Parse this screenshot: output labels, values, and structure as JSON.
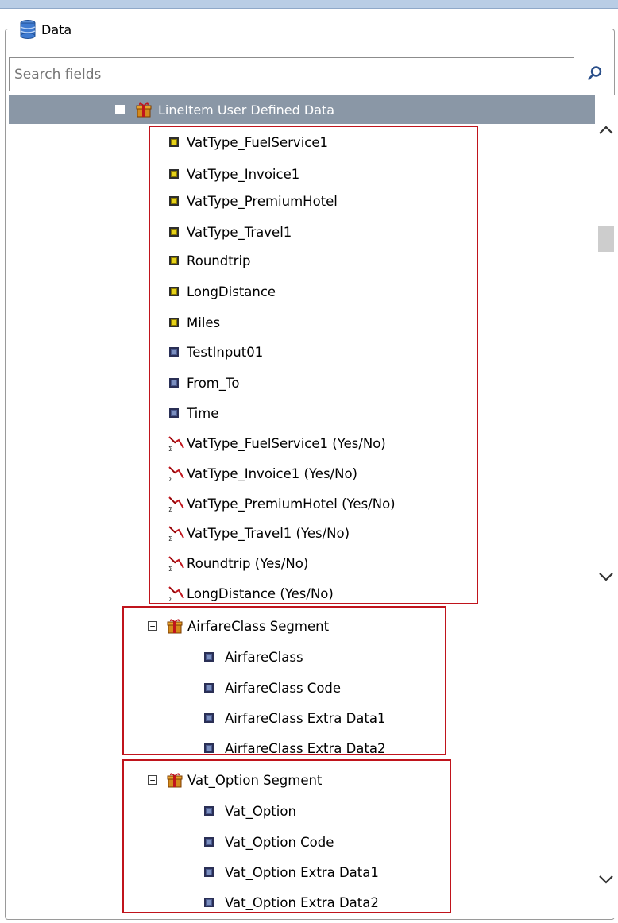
{
  "panel": {
    "title": "Data"
  },
  "search": {
    "placeholder": "Search fields"
  },
  "tree": {
    "root": {
      "label": "LineItem User Defined Data"
    },
    "lineitem_fields": [
      "VatType_FuelService1",
      "VatType_Invoice1",
      "VatType_PremiumHotel",
      "VatType_Travel1",
      "Roundtrip",
      "LongDistance",
      "Miles",
      "TestInput01",
      "From_To",
      "Time",
      "VatType_FuelService1 (Yes/No)",
      "VatType_Invoice1 (Yes/No)",
      "VatType_PremiumHotel (Yes/No)",
      "VatType_Travel1 (Yes/No)",
      "Roundtrip (Yes/No)",
      "LongDistance (Yes/No)"
    ],
    "airfare_segment": {
      "label": "AirfareClass Segment",
      "fields": [
        "AirfareClass",
        "AirfareClass Code",
        "AirfareClass Extra Data1",
        "AirfareClass Extra Data2"
      ]
    },
    "vat_segment": {
      "label": "Vat_Option Segment",
      "fields": [
        "Vat_Option",
        "Vat_Option Code",
        "Vat_Option Extra Data1",
        "Vat_Option Extra Data2"
      ]
    }
  },
  "icons": {
    "panel": "database-icon",
    "search": "search-icon",
    "segment": "gift-box-icon",
    "yellow_field": "yellow-field-icon",
    "blue_field": "blue-field-icon",
    "calc_field": "calculated-field-icon",
    "expander": "collapse-minus-icon"
  },
  "colors": {
    "highlight_box": "#c0141c",
    "header_row": "#8a97a6",
    "yellow_field": "#e6d21a",
    "blue_field": "#7b8fbf"
  }
}
